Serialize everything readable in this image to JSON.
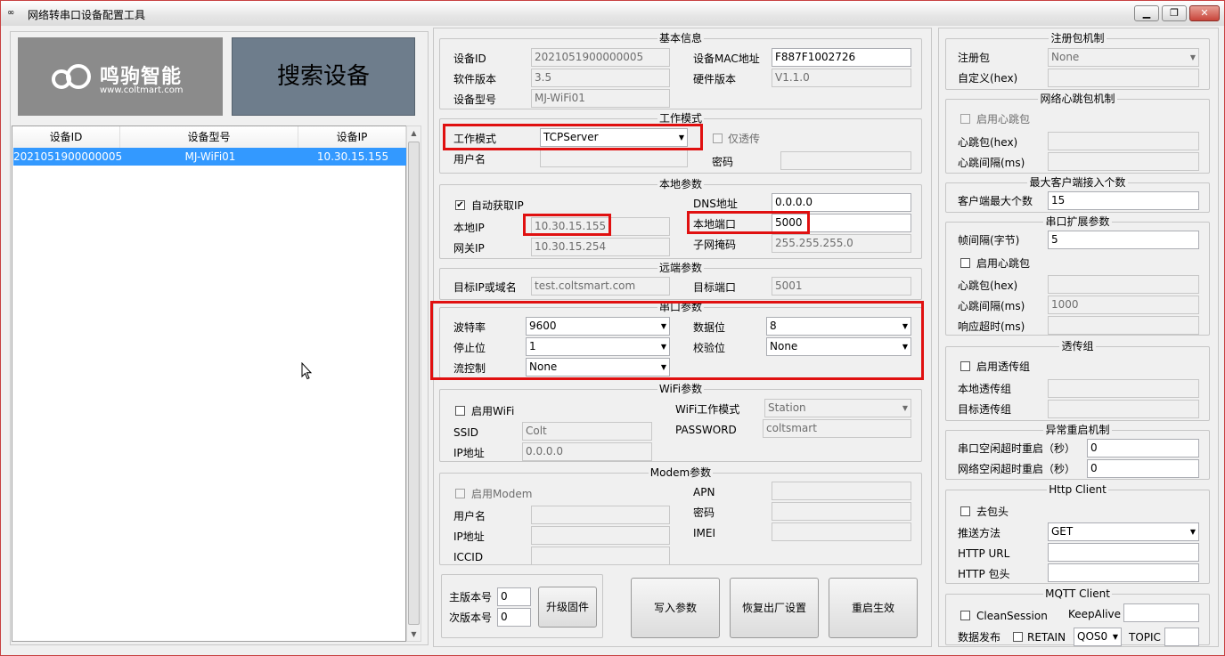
{
  "window": {
    "title": "网络转串口设备配置工具",
    "icon": "app-icon",
    "btn_min": "▁",
    "btn_max": "❐",
    "btn_close": "✕"
  },
  "left": {
    "logo_text": "鸣驹智能",
    "logo_url": "www.coltmart.com",
    "search_button": "搜索设备",
    "columns": [
      "设备ID",
      "设备型号",
      "设备IP"
    ],
    "rows": [
      {
        "id": "2021051900000005",
        "model": "MJ-WiFi01",
        "ip": "10.30.15.155"
      }
    ]
  },
  "basic": {
    "legend": "基本信息",
    "device_id_label": "设备ID",
    "device_id": "2021051900000005",
    "sw_label": "软件版本",
    "sw": "3.5",
    "model_label": "设备型号",
    "model": "MJ-WiFi01",
    "mac_label": "设备MAC地址",
    "mac": "F887F1002726",
    "hw_label": "硬件版本",
    "hw": "V1.1.0"
  },
  "work": {
    "legend": "工作模式",
    "mode_label": "工作模式",
    "mode": "TCPServer",
    "transparent_label": "仅透传",
    "user_label": "用户名",
    "user": "",
    "pwd_label": "密码",
    "pwd": ""
  },
  "local": {
    "legend": "本地参数",
    "auto_ip_label": "自动获取IP",
    "auto_ip": true,
    "ip_label": "本地IP",
    "ip": "10.30.15.155",
    "gw_label": "网关IP",
    "gw": "10.30.15.254",
    "dns_label": "DNS地址",
    "dns": "0.0.0.0",
    "port_label": "本地端口",
    "port": "5000",
    "mask_label": "子网掩码",
    "mask": "255.255.255.0"
  },
  "remote": {
    "legend": "远端参数",
    "target_label": "目标IP或域名",
    "target": "test.coltsmart.com",
    "port_label": "目标端口",
    "port": "5001"
  },
  "serial": {
    "legend": "串口参数",
    "baud_label": "波特率",
    "baud": "9600",
    "stop_label": "停止位",
    "stop": "1",
    "flow_label": "流控制",
    "flow": "None",
    "data_label": "数据位",
    "data": "8",
    "parity_label": "校验位",
    "parity": "None"
  },
  "wifi": {
    "legend": "WiFi参数",
    "enable_label": "启用WiFi",
    "ssid_label": "SSID",
    "ssid": "Colt",
    "ip_label": "IP地址",
    "ip": "0.0.0.0",
    "mode_label": "WiFi工作模式",
    "mode": "Station",
    "pwd_label": "PASSWORD",
    "pwd": "coltsmart"
  },
  "modem": {
    "legend": "Modem参数",
    "enable_label": "启用Modem",
    "user_label": "用户名",
    "ip_label": "IP地址",
    "iccid_label": "ICCID",
    "apn_label": "APN",
    "pwd_label": "密码",
    "imei_label": "IMEI"
  },
  "firmware": {
    "major_label": "主版本号",
    "major": "0",
    "minor_label": "次版本号",
    "minor": "0",
    "upgrade": "升级固件"
  },
  "actions": {
    "write": "写入参数",
    "factory": "恢复出厂设置",
    "restart": "重启生效"
  },
  "register": {
    "legend": "注册包机制",
    "pkg_label": "注册包",
    "pkg": "None",
    "custom_label": "自定义(hex)"
  },
  "heartbeat": {
    "legend": "网络心跳包机制",
    "enable_label": "启用心跳包",
    "hb_label": "心跳包(hex)",
    "interval_label": "心跳间隔(ms)"
  },
  "maxclient": {
    "legend": "最大客户端接入个数",
    "label": "客户端最大个数",
    "value": "15"
  },
  "serialext": {
    "legend": "串口扩展参数",
    "frame_label": "帧间隔(字节)",
    "frame": "5",
    "enable_label": "启用心跳包",
    "hb_label": "心跳包(hex)",
    "interval_label": "心跳间隔(ms)",
    "interval": "1000",
    "timeout_label": "响应超时(ms)"
  },
  "passgroup": {
    "legend": "透传组",
    "enable_label": "启用透传组",
    "local_label": "本地透传组",
    "target_label": "目标透传组"
  },
  "reboot": {
    "legend": "异常重启机制",
    "serial_label": "串口空闲超时重启（秒）",
    "serial": "0",
    "net_label": "网络空闲超时重启（秒）",
    "net": "0"
  },
  "http": {
    "legend": "Http Client",
    "strip_label": "去包头",
    "method_label": "推送方法",
    "method": "GET",
    "url_label": "HTTP URL",
    "head_label": "HTTP 包头"
  },
  "mqtt": {
    "legend": "MQTT Client",
    "clean_label": "CleanSession",
    "keepalive_label": "KeepAlive",
    "publish_label": "数据发布",
    "retain_label": "RETAIN",
    "qos": "QOS0",
    "topic_label": "TOPIC"
  }
}
